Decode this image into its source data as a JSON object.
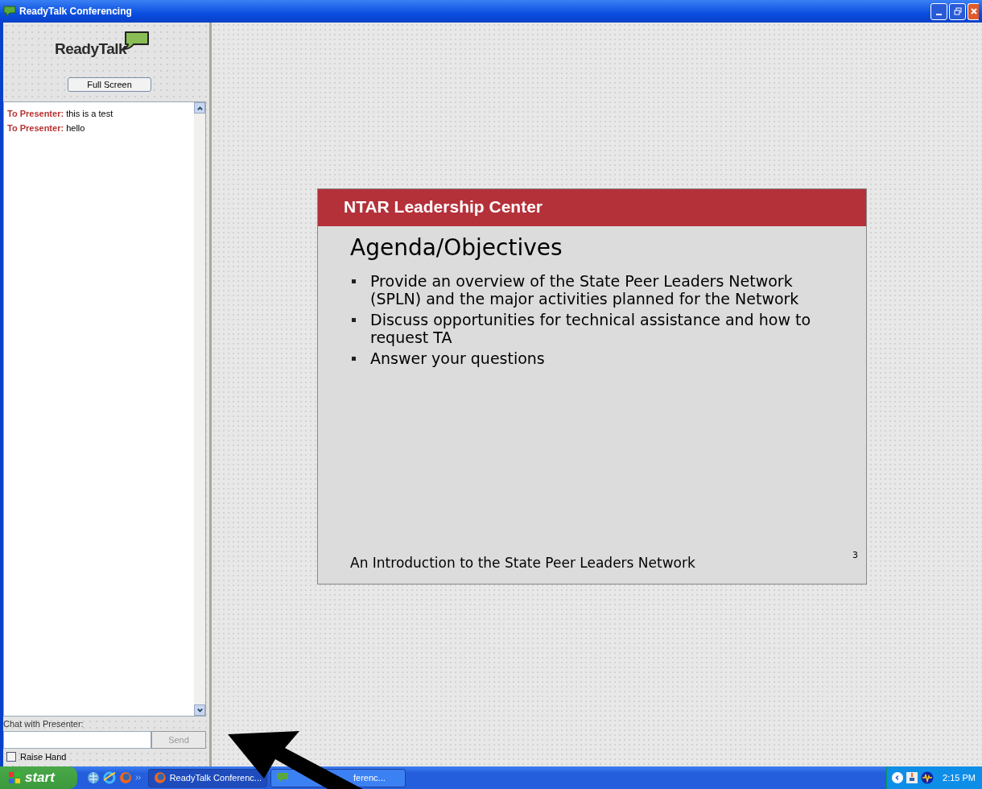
{
  "window": {
    "title": "ReadyTalk Conferencing"
  },
  "sidebar": {
    "logo": "ReadyTalk",
    "full_screen_button": "Full Screen",
    "messages": [
      {
        "sender": "To Presenter:",
        "text": "this is a test"
      },
      {
        "sender": "To Presenter:",
        "text": "hello"
      }
    ],
    "chat_label": "Chat with Presenter:",
    "send_button": "Send",
    "raise_hand": {
      "label": "Raise Hand",
      "checked": false
    }
  },
  "slide": {
    "header": "NTAR Leadership Center",
    "title": "Agenda/Objectives",
    "bullets": [
      "Provide an overview of the State Peer Leaders Network (SPLN) and the major activities planned for the Network",
      "Discuss opportunities for technical assistance and how to request TA",
      "Answer your questions"
    ],
    "footer": "An Introduction to the State Peer Leaders Network",
    "page_number": "3"
  },
  "taskbar": {
    "start": "start",
    "items": [
      {
        "label": "ReadyTalk Conferenc...",
        "selected": true
      },
      {
        "label": "ferenc...",
        "selected": false
      }
    ],
    "clock": "2:15 PM"
  }
}
